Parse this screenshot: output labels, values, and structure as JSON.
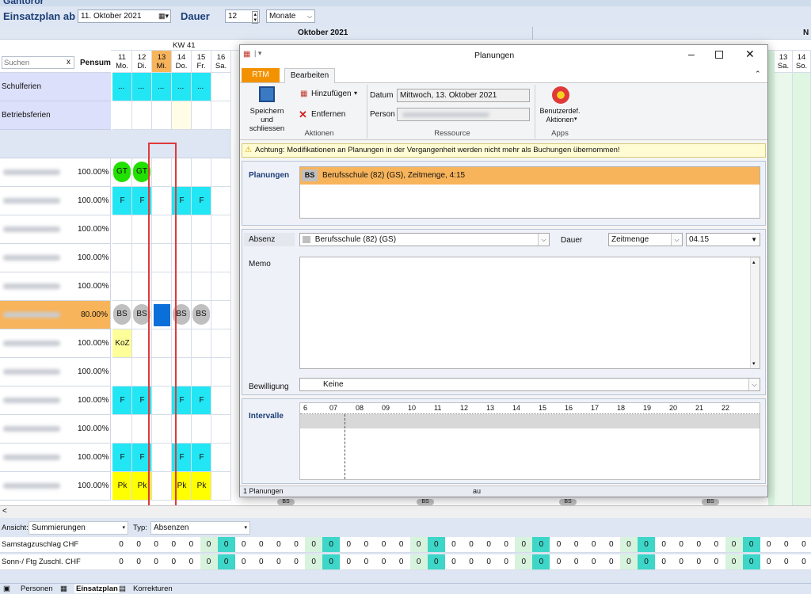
{
  "app": {
    "title": "Gantoror"
  },
  "toolbar": {
    "einsatzplan_label": "Einsatzplan ab",
    "date_value": "11. Oktober 2021",
    "dauer_label": "Dauer",
    "dauer_value": "12",
    "unit_value": "Monate"
  },
  "grid": {
    "month_label": "Oktober 2021",
    "month_next": "N",
    "week_label": "KW 41",
    "search_placeholder": "Suchen",
    "search_clear": "x",
    "pensum_header": "Pensum",
    "days": [
      {
        "num": "11",
        "wd": "Mo."
      },
      {
        "num": "12",
        "wd": "Di."
      },
      {
        "num": "13",
        "wd": "Mi."
      },
      {
        "num": "14",
        "wd": "Do."
      },
      {
        "num": "15",
        "wd": "Fr."
      },
      {
        "num": "16",
        "wd": "Sa."
      }
    ],
    "right_days": [
      {
        "num": "13",
        "wd": "Sa."
      },
      {
        "num": "14",
        "wd": "So."
      }
    ],
    "special_rows": [
      "Schulferien",
      "Betriebsferien"
    ],
    "schulferien_dots": [
      "...",
      "...",
      "...",
      "...",
      "..."
    ],
    "rows": [
      {
        "pensum": "100.00%",
        "cells": [
          "GT",
          "GT",
          "",
          "",
          "",
          ""
        ]
      },
      {
        "pensum": "100.00%",
        "cells": [
          "F",
          "F",
          "",
          "F",
          "F",
          ""
        ]
      },
      {
        "pensum": "100.00%",
        "cells": [
          "",
          "",
          "",
          "",
          "",
          ""
        ]
      },
      {
        "pensum": "100.00%",
        "cells": [
          "",
          "",
          "",
          "",
          "",
          ""
        ]
      },
      {
        "pensum": "100.00%",
        "cells": [
          "",
          "",
          "",
          "",
          "",
          ""
        ]
      },
      {
        "pensum": "80.00%",
        "cells": [
          "BS",
          "BS",
          "",
          "BS",
          "BS",
          ""
        ]
      },
      {
        "pensum": "100.00%",
        "cells": [
          "KoZ",
          "",
          "",
          "",
          "",
          ""
        ]
      },
      {
        "pensum": "100.00%",
        "cells": [
          "",
          "",
          "",
          "",
          "",
          ""
        ]
      },
      {
        "pensum": "100.00%",
        "cells": [
          "F",
          "F",
          "",
          "F",
          "F",
          ""
        ]
      },
      {
        "pensum": "100.00%",
        "cells": [
          "",
          "",
          "",
          "",
          "",
          ""
        ]
      },
      {
        "pensum": "100.00%",
        "cells": [
          "F",
          "F",
          "",
          "F",
          "F",
          ""
        ]
      },
      {
        "pensum": "100.00%",
        "cells": [
          "Pk",
          "Pk",
          "",
          "Pk",
          "Pk",
          ""
        ]
      }
    ],
    "bottom_bs_labels": [
      "BS",
      "BS",
      "BS",
      "BS"
    ]
  },
  "bottom": {
    "ansicht_label": "Ansicht:",
    "ansicht_value": "Summierungen",
    "typ_label": "Typ:",
    "typ_value": "Absenzen",
    "sum_rows": [
      {
        "label": "Samstagzuschlag CHF",
        "values": [
          "0",
          "0",
          "0",
          "0",
          "0",
          "0",
          "0",
          "0",
          "0",
          "0",
          "0",
          "0",
          "0",
          "0",
          "0",
          "0",
          "0",
          "0",
          "0",
          "0",
          "0",
          "0",
          "0",
          "0",
          "0",
          "0",
          "0",
          "0",
          "0",
          "0",
          "0",
          "0",
          "0",
          "0",
          "0",
          "0",
          "0",
          "0",
          "0",
          "0"
        ]
      },
      {
        "label": "Sonn-/ Ftg Zuschl. CHF",
        "values": [
          "0",
          "0",
          "0",
          "0",
          "0",
          "0",
          "0",
          "0",
          "0",
          "0",
          "0",
          "0",
          "0",
          "0",
          "0",
          "0",
          "0",
          "0",
          "0",
          "0",
          "0",
          "0",
          "0",
          "0",
          "0",
          "0",
          "0",
          "0",
          "0",
          "0",
          "0",
          "0",
          "0",
          "0",
          "0",
          "0",
          "0",
          "0",
          "0",
          "0"
        ]
      }
    ]
  },
  "statusbar": {
    "tabs": [
      "Personen",
      "Einsatzplan",
      "Korrekturen"
    ]
  },
  "dialog": {
    "title": "Planungen",
    "tabs": [
      "RTM",
      "Bearbeiten"
    ],
    "buttons": {
      "save": "Speichern und schliessen",
      "add": "Hinzufügen",
      "remove": "Entfernen",
      "custom": "Benutzerdef. Aktionen"
    },
    "fields": {
      "datum_label": "Datum",
      "datum_value": "Mittwoch, 13. Oktober 2021",
      "person_label": "Person"
    },
    "groups": [
      "Aktionen",
      "Ressource",
      "Apps"
    ],
    "warning": "Achtung: Modifikationen an Planungen in der Vergangenheit werden nicht mehr als Buchungen übernommen!",
    "planungen_label": "Planungen",
    "planung_item": {
      "code": "BS",
      "text": "Berufsschule (82) (GS), Zeitmenge, 4:15"
    },
    "absenz_label": "Absenz",
    "absenz_value": "Berufsschule (82) (GS)",
    "dauer_label": "Dauer",
    "dauer_type": "Zeitmenge",
    "dauer_value": "04.15",
    "memo_label": "Memo",
    "bewilligung_label": "Bewilligung",
    "bewilligung_value": "Keine",
    "intervalle_label": "Intervalle",
    "hours": [
      "6",
      "07",
      "08",
      "09",
      "10",
      "11",
      "12",
      "13",
      "14",
      "15",
      "16",
      "17",
      "18",
      "19",
      "20",
      "21",
      "22"
    ],
    "footer_count": "1 Planungen",
    "footer_au": "au"
  },
  "colors": {
    "accent": "#1d3e78",
    "green": "#22e000",
    "cyan": "#22e6f4",
    "yellow": "#ffff00",
    "grey": "#bfbfbf",
    "blue": "#0a6fd8",
    "orange": "#f8b45a",
    "red": "#e0393a"
  }
}
